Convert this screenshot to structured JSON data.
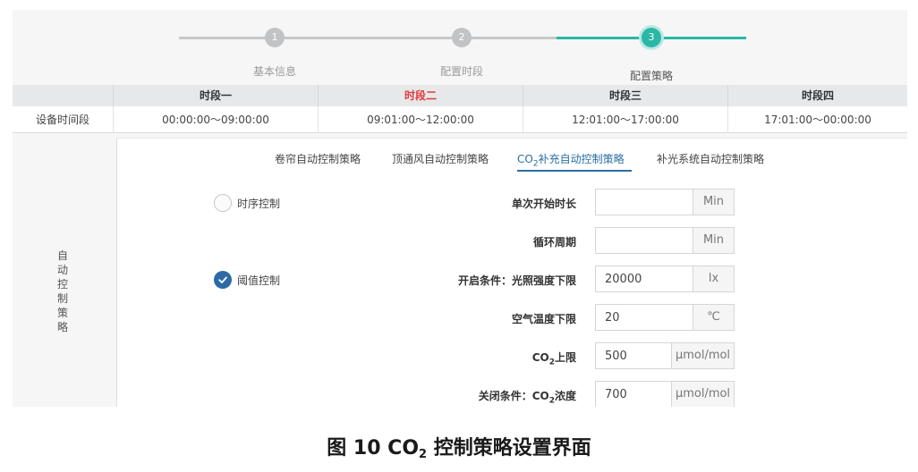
{
  "stepper": {
    "steps": [
      {
        "number": "1",
        "label": "基本信息"
      },
      {
        "number": "2",
        "label": "配置时段"
      },
      {
        "number": "3",
        "label": "配置策略"
      }
    ],
    "active_step": 3
  },
  "periods_table": {
    "headers": [
      "时段一",
      "时段二",
      "时段三",
      "时段四"
    ],
    "highlighted_header": "时段二",
    "row_label": "设备时间段",
    "time_ranges": [
      "00:00:00～09:00:00",
      "09:01:00～12:00:00",
      "12:01:00～17:00:00",
      "17:01:00～00:00:00"
    ]
  },
  "strategy": {
    "side_label": "自\n动\n控\n制\n策\n略",
    "tabs": {
      "curtain": "卷帘自动控制策略",
      "top_vent": "顶通风自动控制策略",
      "co2_prefix": "CO",
      "co2_sub": "2",
      "co2_suffix": "补充自动控制策略",
      "light": "补光系统自动控制策略"
    },
    "active_tab": "co2",
    "modes": {
      "timing": {
        "label": "时序控制",
        "selected": false
      },
      "threshold": {
        "label": "阈值控制",
        "selected": true
      }
    },
    "fields": {
      "single_duration": {
        "label": "单次开始时长",
        "value": "",
        "unit": "Min"
      },
      "cycle_period": {
        "label": "循环周期",
        "value": "",
        "unit": "Min"
      },
      "light_lower": {
        "label": "开启条件：光照强度下限",
        "value": "20000",
        "unit": "lx"
      },
      "air_temp_lower": {
        "label": "空气温度下限",
        "value": "20",
        "unit": "℃"
      },
      "co2_upper": {
        "label_prefix": "CO",
        "label_sub": "2",
        "label_suffix": "上限",
        "value": "500",
        "unit": "μmol/mol"
      },
      "co2_close": {
        "label_prefix": "关闭条件：CO",
        "label_sub": "2",
        "label_suffix": "浓度",
        "value": "700",
        "unit": "μmol/mol"
      }
    },
    "colors": {
      "accent_teal": "#2bb7a6",
      "accent_blue": "#2a6ea6",
      "highlight_red": "#e03b3b"
    }
  },
  "caption": {
    "prefix": "图 10 CO",
    "sub": "2",
    "suffix": " 控制策略设置界面"
  }
}
